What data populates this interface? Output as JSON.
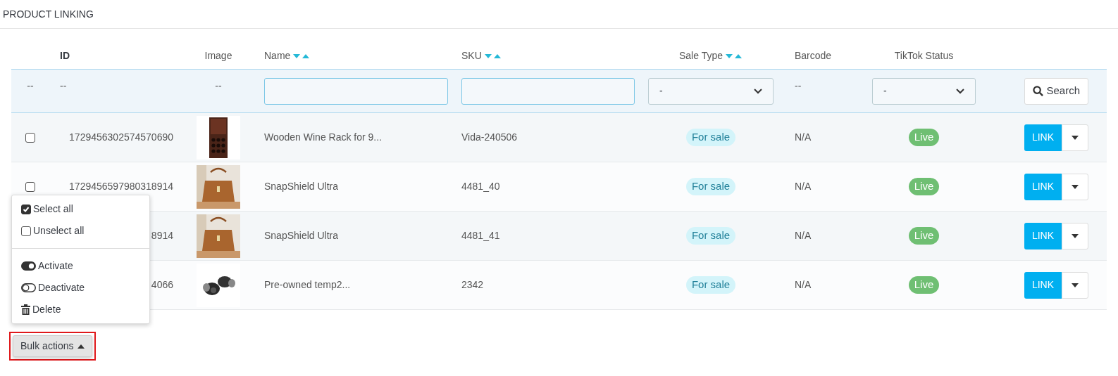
{
  "title": "PRODUCT LINKING",
  "columns": [
    {
      "label": "ID",
      "sortable": false
    },
    {
      "label": "Image",
      "sortable": false
    },
    {
      "label": "Name",
      "sortable": true
    },
    {
      "label": "SKU",
      "sortable": true
    },
    {
      "label": "Sale Type",
      "sortable": true
    },
    {
      "label": "Barcode",
      "sortable": false
    },
    {
      "label": "TikTok Status",
      "sortable": false
    }
  ],
  "filter_row": [
    {
      "kind": "text",
      "text": "--"
    },
    {
      "kind": "text",
      "text": "--"
    },
    {
      "kind": "text",
      "text": "--"
    },
    {
      "kind": "input"
    },
    {
      "kind": "input"
    },
    {
      "kind": "select",
      "value": "-"
    },
    {
      "kind": "text",
      "text": "--"
    },
    {
      "kind": "select",
      "value": "-"
    },
    {
      "kind": "button",
      "label": "Search"
    }
  ],
  "rows": [
    {
      "checked": false,
      "id": "1729456302574570690",
      "name": "Wooden Wine Rack for 9...",
      "sku": "Vida-240506",
      "sale_type": "For sale",
      "barcode": "N/A",
      "tiktok_status": "Live",
      "action": "LINK"
    },
    {
      "checked": false,
      "id": "1729456597980318914",
      "name": "SnapShield Ultra",
      "sku": "4481_40",
      "sale_type": "For sale",
      "barcode": "N/A",
      "tiktok_status": "Live",
      "action": "LINK"
    },
    {
      "id": "8914",
      "name": "SnapShield Ultra",
      "sku": "4481_41",
      "sale_type": "For sale",
      "barcode": "N/A",
      "tiktok_status": "Live",
      "action": "LINK"
    },
    {
      "id": "4066",
      "name": "Pre-owned temp2...",
      "sku": "2342",
      "sale_type": "For sale",
      "barcode": "N/A",
      "tiktok_status": "Live",
      "action": "LINK"
    }
  ],
  "bulk_menu": {
    "groups": [
      [
        {
          "kind": "checkbox",
          "label": "Select all",
          "checked": true
        },
        {
          "kind": "checkbox",
          "label": "Unselect all",
          "checked": false
        }
      ],
      [
        {
          "kind": "toggle",
          "label": "Activate",
          "on": true
        },
        {
          "kind": "toggle",
          "label": "Deactivate",
          "on": false
        },
        {
          "kind": "trash",
          "label": "Delete"
        }
      ]
    ]
  },
  "bulk_button": {
    "label": "Bulk actions",
    "expanded": true,
    "highlighted": true
  }
}
